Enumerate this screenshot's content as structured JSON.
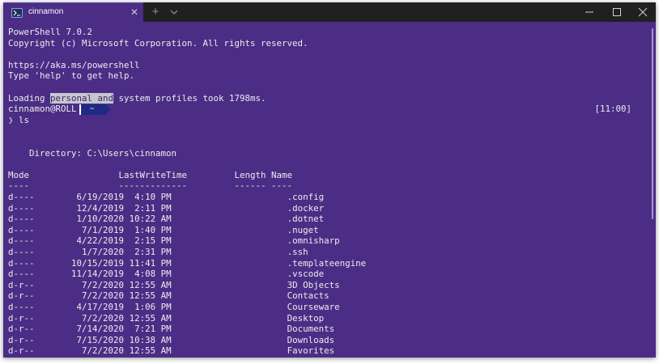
{
  "tab": {
    "title": "cinnamon",
    "close_glyph": "✕",
    "new_tab_glyph": "+"
  },
  "window_controls": {
    "minimize_icon": "minimize-icon",
    "maximize_icon": "maximize-icon",
    "close_icon": "close-icon"
  },
  "terminal": {
    "header_lines": [
      "PowerShell 7.0.2",
      "Copyright (c) Microsoft Corporation. All rights reserved.",
      "https://aka.ms/powershell",
      "Type 'help' to get help."
    ],
    "loading": {
      "prefix": "Loading ",
      "selected": "personal and",
      "suffix": " system profiles took 1798ms."
    },
    "prompt": {
      "user_host": "cinnamon@ROLL",
      "path": "~",
      "clock": "[11:00]",
      "arrow": "❯",
      "command": "ls"
    },
    "directory_line": "    Directory: C:\\Users\\cinnamon",
    "table_header": "Mode                 LastWriteTime         Length Name",
    "table_rule": "----                 -------------         ------ ----",
    "rows": [
      {
        "mode": "d----",
        "date": "6/19/2019",
        "time": "4:10 PM",
        "name": ".config"
      },
      {
        "mode": "d----",
        "date": "12/4/2019",
        "time": "2:11 PM",
        "name": ".docker"
      },
      {
        "mode": "d----",
        "date": "1/10/2020",
        "time": "10:22 AM",
        "name": ".dotnet"
      },
      {
        "mode": "d----",
        "date": "7/1/2019",
        "time": "1:40 PM",
        "name": ".nuget"
      },
      {
        "mode": "d----",
        "date": "4/22/2019",
        "time": "2:15 PM",
        "name": ".omnisharp"
      },
      {
        "mode": "d----",
        "date": "1/7/2020",
        "time": "2:31 PM",
        "name": ".ssh"
      },
      {
        "mode": "d----",
        "date": "10/15/2019",
        "time": "11:41 PM",
        "name": ".templateengine"
      },
      {
        "mode": "d----",
        "date": "11/14/2019",
        "time": "4:08 PM",
        "name": ".vscode"
      },
      {
        "mode": "d-r--",
        "date": "7/2/2020",
        "time": "12:55 AM",
        "name": "3D Objects"
      },
      {
        "mode": "d-r--",
        "date": "7/2/2020",
        "time": "12:55 AM",
        "name": "Contacts"
      },
      {
        "mode": "d----",
        "date": "4/17/2019",
        "time": "1:06 PM",
        "name": "Courseware"
      },
      {
        "mode": "d-r--",
        "date": "7/2/2020",
        "time": "12:55 AM",
        "name": "Desktop"
      },
      {
        "mode": "d-r--",
        "date": "7/14/2020",
        "time": "7:21 PM",
        "name": "Documents"
      },
      {
        "mode": "d-r--",
        "date": "7/15/2020",
        "time": "10:38 AM",
        "name": "Downloads"
      },
      {
        "mode": "d-r--",
        "date": "7/2/2020",
        "time": "12:55 AM",
        "name": "Favorites"
      }
    ]
  }
}
